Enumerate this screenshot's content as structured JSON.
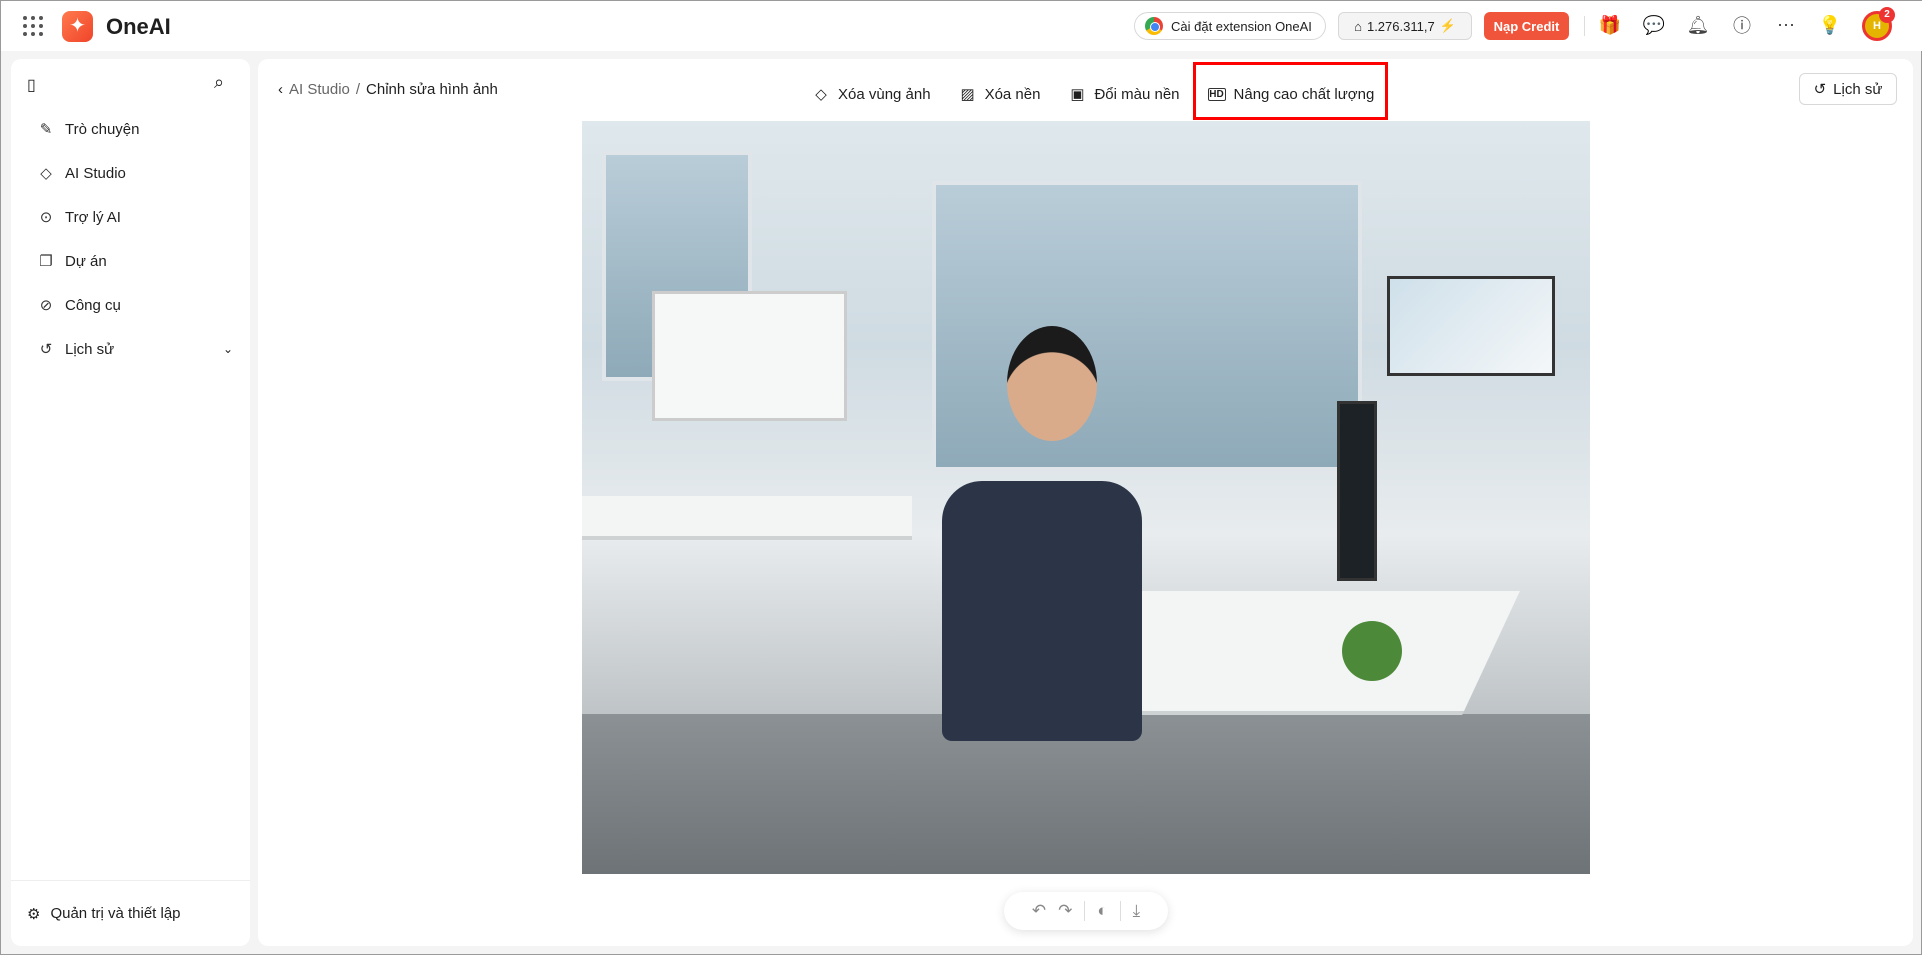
{
  "app": {
    "brand": "OneAI"
  },
  "topbar": {
    "extension_label": "Cài đặt extension OneAI",
    "credit_balance": "1.276.311,7",
    "topup_label": "Nạp Credit",
    "notification_count": "2",
    "avatar_initials": "H"
  },
  "sidebar": {
    "items": [
      {
        "label": "Trò chuyện"
      },
      {
        "label": "AI Studio"
      },
      {
        "label": "Trợ lý AI"
      },
      {
        "label": "Dự án"
      },
      {
        "label": "Công cụ"
      },
      {
        "label": "Lịch sử"
      }
    ],
    "settings_label": "Quản trị và thiết lập"
  },
  "main": {
    "breadcrumb": {
      "parent": "AI Studio",
      "separator": "/",
      "current": "Chỉnh sửa hình ảnh"
    },
    "tools": [
      {
        "label": "Xóa vùng ảnh"
      },
      {
        "label": "Xóa nền"
      },
      {
        "label": "Đổi màu nền"
      },
      {
        "label": "Nâng cao chất lượng"
      }
    ],
    "history_label": "Lịch sử"
  },
  "colors": {
    "accent": "#f0543a",
    "highlight": "#ff0000"
  }
}
